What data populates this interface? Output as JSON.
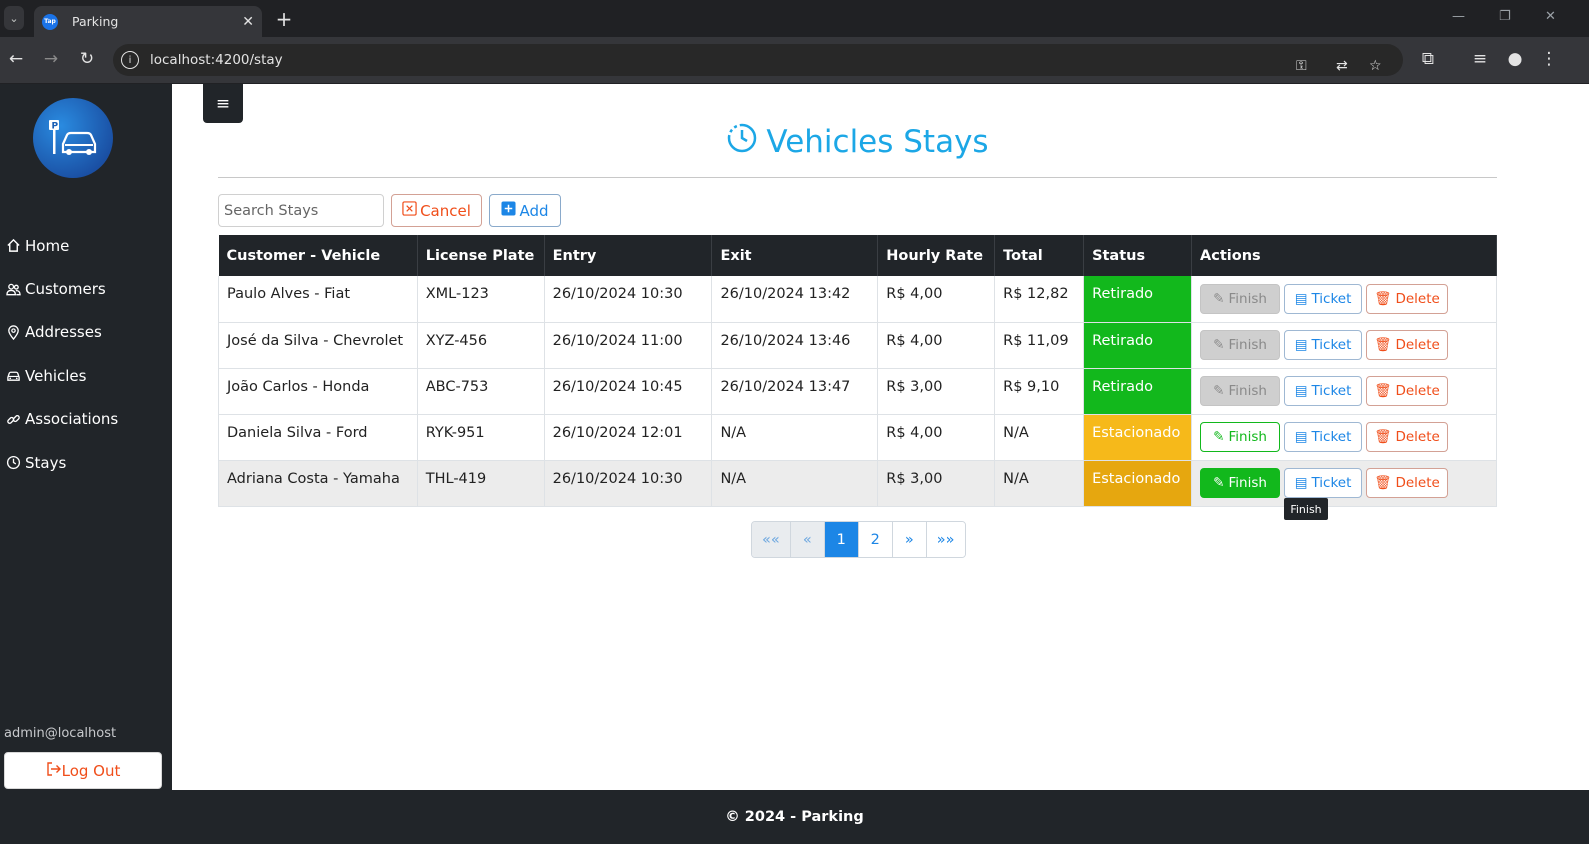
{
  "browser": {
    "tab_title": "Parking",
    "favicon_text": "Tap",
    "url": "localhost:4200/stay"
  },
  "sidebar": {
    "items": [
      {
        "label": "Home",
        "icon": "home-icon"
      },
      {
        "label": "Customers",
        "icon": "users-icon"
      },
      {
        "label": "Addresses",
        "icon": "map-pin-icon"
      },
      {
        "label": "Vehicles",
        "icon": "car-icon"
      },
      {
        "label": "Associations",
        "icon": "link-icon"
      },
      {
        "label": "Stays",
        "icon": "clock-icon"
      }
    ],
    "user_email": "admin@localhost",
    "logout_label": "Log Out"
  },
  "main": {
    "title": "Vehicles Stays",
    "search_placeholder": "Search Stays",
    "cancel_label": "Cancel",
    "add_label": "Add",
    "columns": [
      "Customer - Vehicle",
      "License Plate",
      "Entry",
      "Exit",
      "Hourly Rate",
      "Total",
      "Status",
      "Actions"
    ],
    "rows": [
      {
        "customer_vehicle": "Paulo Alves - Fiat",
        "plate": "XML-123",
        "entry": "26/10/2024 10:30",
        "exit": "26/10/2024 13:42",
        "rate": "R$ 4,00",
        "total": "R$ 12,82",
        "status": "Retirado"
      },
      {
        "customer_vehicle": "José da Silva - Chevrolet",
        "plate": "XYZ-456",
        "entry": "26/10/2024 11:00",
        "exit": "26/10/2024 13:46",
        "rate": "R$ 4,00",
        "total": "R$ 11,09",
        "status": "Retirado"
      },
      {
        "customer_vehicle": "João Carlos - Honda",
        "plate": "ABC-753",
        "entry": "26/10/2024 10:45",
        "exit": "26/10/2024 13:47",
        "rate": "R$ 3,00",
        "total": "R$ 9,10",
        "status": "Retirado"
      },
      {
        "customer_vehicle": "Daniela Silva - Ford",
        "plate": "RYK-951",
        "entry": "26/10/2024 12:01",
        "exit": "N/A",
        "rate": "R$ 4,00",
        "total": "N/A",
        "status": "Estacionado"
      },
      {
        "customer_vehicle": "Adriana Costa - Yamaha",
        "plate": "THL-419",
        "entry": "26/10/2024 10:30",
        "exit": "N/A",
        "rate": "R$ 3,00",
        "total": "N/A",
        "status": "Estacionado"
      }
    ],
    "actions": {
      "finish": "Finish",
      "ticket": "Ticket",
      "delete": "Delete"
    },
    "tooltip": "Finish",
    "pagination": [
      "««",
      "«",
      "1",
      "2",
      "»",
      "»»"
    ],
    "current_page": "1"
  },
  "footer": "© 2024 - Parking",
  "colors": {
    "accent": "#1ca7e6",
    "primary": "#1c86e6",
    "danger": "#f04e1a",
    "success": "#12b81c",
    "warning": "#f6b91a",
    "dark": "#212529"
  }
}
